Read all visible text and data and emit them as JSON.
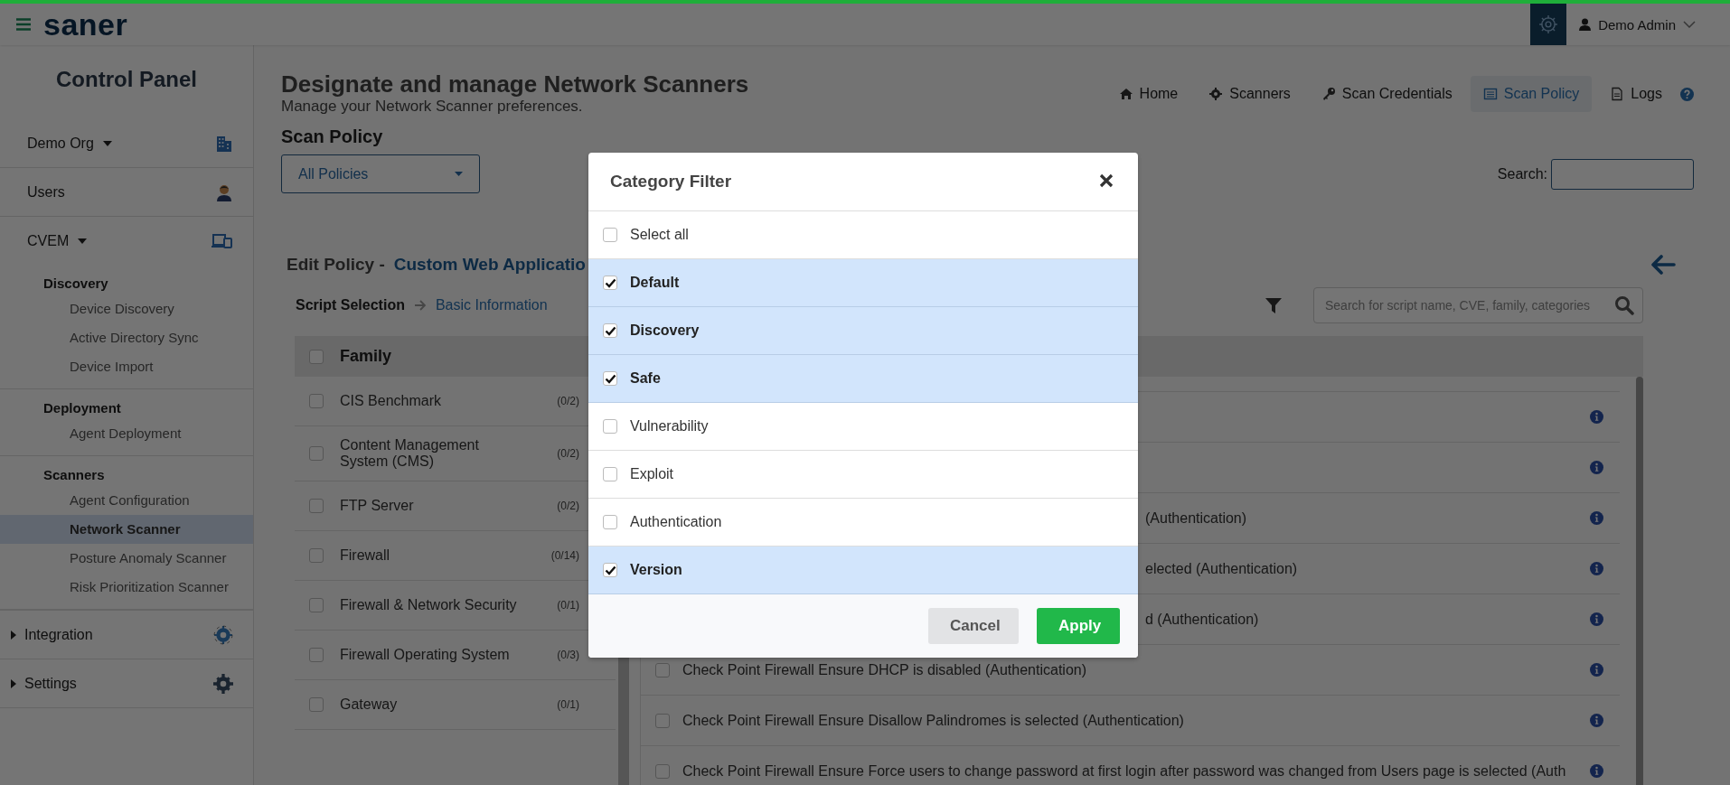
{
  "header": {
    "logo": "saner",
    "user": "Demo Admin"
  },
  "sidebar": {
    "title": "Control Panel",
    "items": [
      {
        "label": "Demo Org",
        "kind": "org"
      },
      {
        "label": "Users",
        "kind": "user"
      },
      {
        "label": "CVEM",
        "kind": "module",
        "expanded": true,
        "groups": [
          {
            "title": "Discovery",
            "items": [
              {
                "label": "Device Discovery",
                "selected": false
              },
              {
                "label": "Active Directory Sync",
                "selected": false
              },
              {
                "label": "Device Import",
                "selected": false
              }
            ]
          },
          {
            "title": "Deployment",
            "items": [
              {
                "label": "Agent Deployment",
                "selected": false
              }
            ]
          },
          {
            "title": "Scanners",
            "items": [
              {
                "label": "Agent Configuration",
                "selected": false
              },
              {
                "label": "Network Scanner",
                "selected": true
              },
              {
                "label": "Posture Anomaly Scanner",
                "selected": false
              },
              {
                "label": "Risk Prioritization Scanner",
                "selected": false
              }
            ]
          }
        ]
      },
      {
        "label": "Integration",
        "kind": "integration",
        "expanded": false
      },
      {
        "label": "Settings",
        "kind": "settings",
        "expanded": false
      }
    ]
  },
  "page": {
    "title": "Designate and manage Network Scanners",
    "subtitle": "Manage your Network Scanner preferences.",
    "section": "Scan Policy",
    "policy_dropdown": "All Policies",
    "search_label": "Search:",
    "nav": [
      {
        "label": "Home",
        "kind": "home",
        "selected": false
      },
      {
        "label": "Scanners",
        "kind": "scanners",
        "selected": false
      },
      {
        "label": "Scan Credentials",
        "kind": "credentials",
        "selected": false
      },
      {
        "label": "Scan Policy",
        "kind": "policy",
        "selected": true
      },
      {
        "label": "Logs",
        "kind": "logs",
        "selected": false
      }
    ]
  },
  "edit": {
    "label": "Edit Policy -",
    "policy_name": "Custom Web Applicatio",
    "steps": [
      {
        "label": "Script Selection",
        "selected": true
      },
      {
        "label": "Basic Information",
        "selected": false
      }
    ],
    "script_search": {
      "placeholder": "Search for script name, CVE, family, categories"
    }
  },
  "family_table": {
    "header": {
      "label": "Family",
      "checked": false
    },
    "rows": [
      {
        "name": "CIS Benchmark",
        "count": "(0/2)",
        "checked": false
      },
      {
        "name": "Content Management System (CMS)",
        "count": "(0/2)",
        "checked": false
      },
      {
        "name": "FTP Server",
        "count": "(0/2)",
        "checked": false
      },
      {
        "name": "Firewall",
        "count": "(0/14)",
        "checked": false
      },
      {
        "name": "Firewall & Network Security",
        "count": "(0/1)",
        "checked": false
      },
      {
        "name": "Firewall Operating System",
        "count": "(0/3)",
        "checked": false
      },
      {
        "name": "Gateway",
        "count": "(0/1)",
        "checked": false
      }
    ]
  },
  "scripts_table": {
    "rows": [
      {
        "kind": "hidden"
      },
      {
        "kind": "hidden"
      },
      {
        "kind": "partial",
        "text": "(Authentication)"
      },
      {
        "kind": "partial",
        "text": "elected (Authentication)"
      },
      {
        "kind": "partial",
        "text": "d (Authentication)"
      },
      {
        "kind": "full",
        "text": "Check Point Firewall Ensure DHCP is disabled (Authentication)",
        "checked": false
      },
      {
        "kind": "full",
        "text": "Check Point Firewall Ensure Disallow Palindromes is selected (Authentication)",
        "checked": false
      },
      {
        "kind": "full",
        "text": "Check Point Firewall Ensure Force users to change password at first login after password was changed from Users page is selected (Auth",
        "checked": false
      }
    ]
  },
  "modal": {
    "title": "Category Filter",
    "options": [
      {
        "label": "Select all",
        "checked": false
      },
      {
        "label": "Default",
        "checked": true
      },
      {
        "label": "Discovery",
        "checked": true
      },
      {
        "label": "Safe",
        "checked": true
      },
      {
        "label": "Vulnerability",
        "checked": false
      },
      {
        "label": "Exploit",
        "checked": false
      },
      {
        "label": "Authentication",
        "checked": false
      },
      {
        "label": "Version",
        "checked": true
      }
    ],
    "buttons": [
      {
        "label": "Cancel",
        "kind": "secondary"
      },
      {
        "label": "Apply",
        "kind": "primary"
      }
    ]
  }
}
